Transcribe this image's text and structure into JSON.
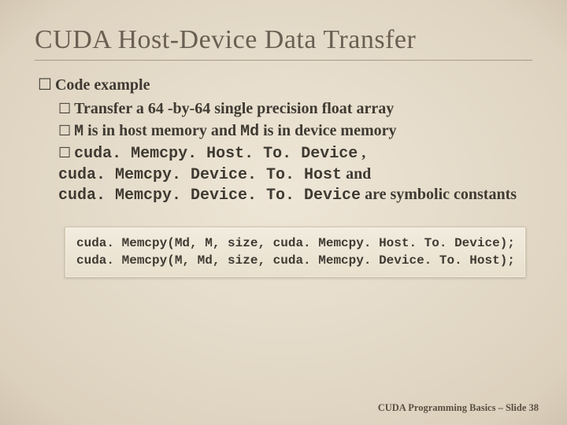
{
  "title": "CUDA Host-Device Data Transfer",
  "lvl1": {
    "text": "Code example"
  },
  "bullets": {
    "b1": {
      "text": "Transfer a 64 -by-64 single precision float array"
    },
    "b2": {
      "m1": "M",
      "mid": " is in host memory and ",
      "m2": "Md",
      "tail": " is in device memory"
    },
    "b3": {
      "c1": "cuda. Memcpy. Host. To. Device",
      "sep1": " , ",
      "c2": "cuda. Memcpy. Device. To. Host",
      "mid": " and ",
      "c3": "cuda. Memcpy. Device. To. Device",
      "tail": " are symbolic constants"
    }
  },
  "code": {
    "l1": "cuda. Memcpy(Md, M, size, cuda. Memcpy. Host. To. Device);",
    "l2": "cuda. Memcpy(M, Md, size, cuda. Memcpy. Device. To. Host);"
  },
  "footer": {
    "label": "CUDA Programming Basics – Slide ",
    "num": "38"
  },
  "glyph": {
    "square": "☐"
  }
}
